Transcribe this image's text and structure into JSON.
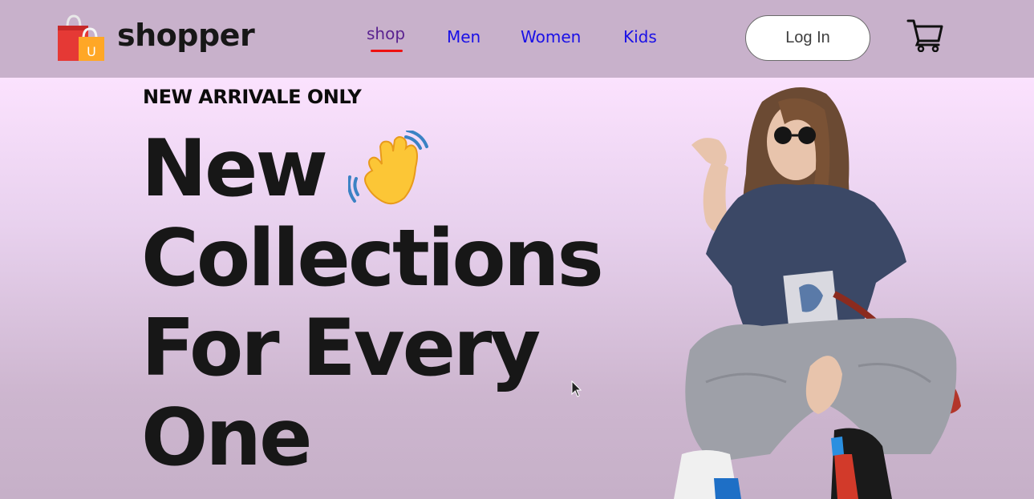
{
  "brand": {
    "name": "shopper",
    "logo_badge": "U"
  },
  "nav": {
    "items": [
      {
        "label": "shop",
        "active": true
      },
      {
        "label": "Men",
        "active": false
      },
      {
        "label": "Women",
        "active": false
      },
      {
        "label": "Kids",
        "active": false
      }
    ]
  },
  "header": {
    "login_label": "Log In",
    "cart_icon": "cart-icon"
  },
  "hero": {
    "kicker": "NEW ARRIVALE ONLY",
    "title_lines": [
      "New",
      "Collections",
      "For Every",
      "One"
    ],
    "wave_icon": "waving-hand-icon",
    "image": "hero-model-image"
  },
  "colors": {
    "nav_bg": "#c8b1cb",
    "link": "#1a10e6",
    "active_link": "#5a2390",
    "active_underline": "#e11111",
    "hero_gradient_top": "#fbe2fe",
    "hero_gradient_bottom": "#c6b0c8",
    "title_text": "#171717"
  }
}
